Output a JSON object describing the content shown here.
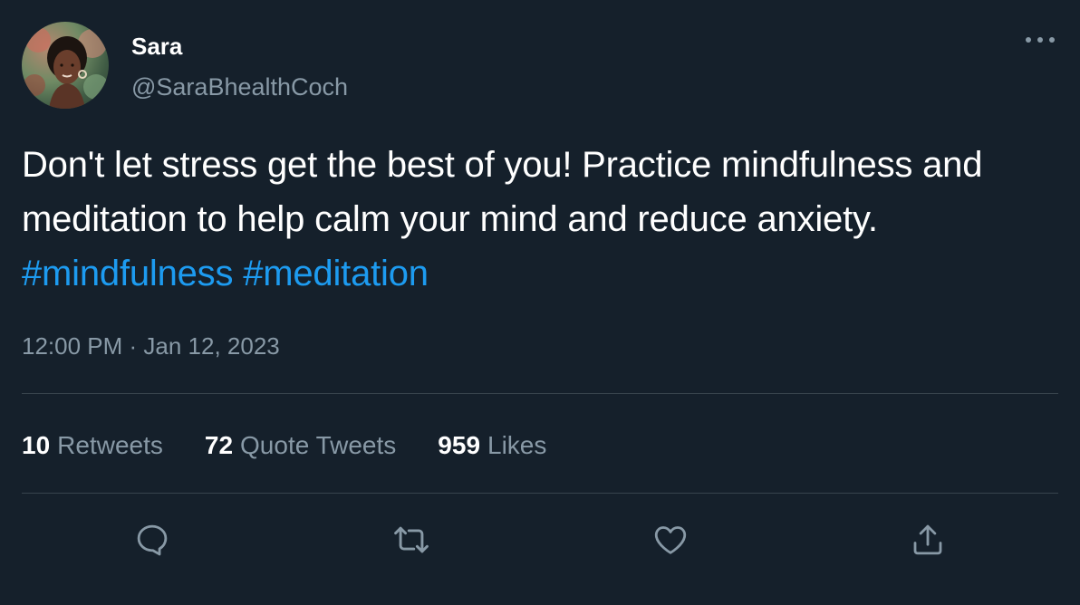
{
  "author": {
    "display_name": "Sara",
    "handle": "@SaraBhealthCoch"
  },
  "tweet": {
    "text": "Don't let stress get the best of you! Practice mindfulness and meditation to help calm your mind and reduce anxiety.",
    "hashtags": [
      "#mindfulness",
      "#meditation"
    ],
    "timestamp": "12:00 PM · Jan 12, 2023"
  },
  "stats": [
    {
      "count": "10",
      "label": "Retweets"
    },
    {
      "count": "72",
      "label": "Quote Tweets"
    },
    {
      "count": "959",
      "label": "Likes"
    }
  ],
  "actions": [
    "reply-icon",
    "retweet-icon",
    "like-icon",
    "share-icon"
  ],
  "colors": {
    "background": "#15202b",
    "text": "#ffffff",
    "secondary_text": "#8899a6",
    "hashtag": "#1d9bf0",
    "divider": "#38444d"
  }
}
